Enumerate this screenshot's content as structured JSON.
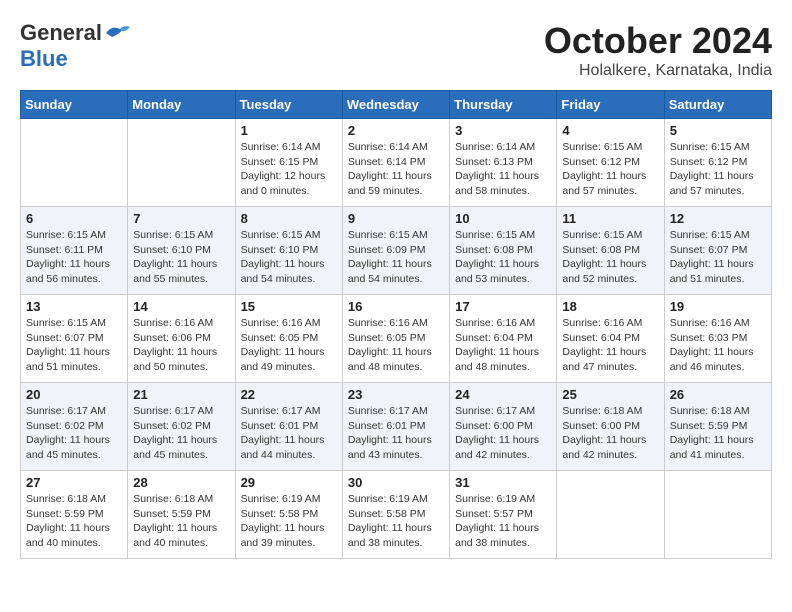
{
  "header": {
    "logo_general": "General",
    "logo_blue": "Blue",
    "month": "October 2024",
    "location": "Holalkere, Karnataka, India"
  },
  "weekdays": [
    "Sunday",
    "Monday",
    "Tuesday",
    "Wednesday",
    "Thursday",
    "Friday",
    "Saturday"
  ],
  "weeks": [
    [
      {
        "day": "",
        "info": ""
      },
      {
        "day": "",
        "info": ""
      },
      {
        "day": "1",
        "info": "Sunrise: 6:14 AM\nSunset: 6:15 PM\nDaylight: 12 hours and 0 minutes."
      },
      {
        "day": "2",
        "info": "Sunrise: 6:14 AM\nSunset: 6:14 PM\nDaylight: 11 hours and 59 minutes."
      },
      {
        "day": "3",
        "info": "Sunrise: 6:14 AM\nSunset: 6:13 PM\nDaylight: 11 hours and 58 minutes."
      },
      {
        "day": "4",
        "info": "Sunrise: 6:15 AM\nSunset: 6:12 PM\nDaylight: 11 hours and 57 minutes."
      },
      {
        "day": "5",
        "info": "Sunrise: 6:15 AM\nSunset: 6:12 PM\nDaylight: 11 hours and 57 minutes."
      }
    ],
    [
      {
        "day": "6",
        "info": "Sunrise: 6:15 AM\nSunset: 6:11 PM\nDaylight: 11 hours and 56 minutes."
      },
      {
        "day": "7",
        "info": "Sunrise: 6:15 AM\nSunset: 6:10 PM\nDaylight: 11 hours and 55 minutes."
      },
      {
        "day": "8",
        "info": "Sunrise: 6:15 AM\nSunset: 6:10 PM\nDaylight: 11 hours and 54 minutes."
      },
      {
        "day": "9",
        "info": "Sunrise: 6:15 AM\nSunset: 6:09 PM\nDaylight: 11 hours and 54 minutes."
      },
      {
        "day": "10",
        "info": "Sunrise: 6:15 AM\nSunset: 6:08 PM\nDaylight: 11 hours and 53 minutes."
      },
      {
        "day": "11",
        "info": "Sunrise: 6:15 AM\nSunset: 6:08 PM\nDaylight: 11 hours and 52 minutes."
      },
      {
        "day": "12",
        "info": "Sunrise: 6:15 AM\nSunset: 6:07 PM\nDaylight: 11 hours and 51 minutes."
      }
    ],
    [
      {
        "day": "13",
        "info": "Sunrise: 6:15 AM\nSunset: 6:07 PM\nDaylight: 11 hours and 51 minutes."
      },
      {
        "day": "14",
        "info": "Sunrise: 6:16 AM\nSunset: 6:06 PM\nDaylight: 11 hours and 50 minutes."
      },
      {
        "day": "15",
        "info": "Sunrise: 6:16 AM\nSunset: 6:05 PM\nDaylight: 11 hours and 49 minutes."
      },
      {
        "day": "16",
        "info": "Sunrise: 6:16 AM\nSunset: 6:05 PM\nDaylight: 11 hours and 48 minutes."
      },
      {
        "day": "17",
        "info": "Sunrise: 6:16 AM\nSunset: 6:04 PM\nDaylight: 11 hours and 48 minutes."
      },
      {
        "day": "18",
        "info": "Sunrise: 6:16 AM\nSunset: 6:04 PM\nDaylight: 11 hours and 47 minutes."
      },
      {
        "day": "19",
        "info": "Sunrise: 6:16 AM\nSunset: 6:03 PM\nDaylight: 11 hours and 46 minutes."
      }
    ],
    [
      {
        "day": "20",
        "info": "Sunrise: 6:17 AM\nSunset: 6:02 PM\nDaylight: 11 hours and 45 minutes."
      },
      {
        "day": "21",
        "info": "Sunrise: 6:17 AM\nSunset: 6:02 PM\nDaylight: 11 hours and 45 minutes."
      },
      {
        "day": "22",
        "info": "Sunrise: 6:17 AM\nSunset: 6:01 PM\nDaylight: 11 hours and 44 minutes."
      },
      {
        "day": "23",
        "info": "Sunrise: 6:17 AM\nSunset: 6:01 PM\nDaylight: 11 hours and 43 minutes."
      },
      {
        "day": "24",
        "info": "Sunrise: 6:17 AM\nSunset: 6:00 PM\nDaylight: 11 hours and 42 minutes."
      },
      {
        "day": "25",
        "info": "Sunrise: 6:18 AM\nSunset: 6:00 PM\nDaylight: 11 hours and 42 minutes."
      },
      {
        "day": "26",
        "info": "Sunrise: 6:18 AM\nSunset: 5:59 PM\nDaylight: 11 hours and 41 minutes."
      }
    ],
    [
      {
        "day": "27",
        "info": "Sunrise: 6:18 AM\nSunset: 5:59 PM\nDaylight: 11 hours and 40 minutes."
      },
      {
        "day": "28",
        "info": "Sunrise: 6:18 AM\nSunset: 5:59 PM\nDaylight: 11 hours and 40 minutes."
      },
      {
        "day": "29",
        "info": "Sunrise: 6:19 AM\nSunset: 5:58 PM\nDaylight: 11 hours and 39 minutes."
      },
      {
        "day": "30",
        "info": "Sunrise: 6:19 AM\nSunset: 5:58 PM\nDaylight: 11 hours and 38 minutes."
      },
      {
        "day": "31",
        "info": "Sunrise: 6:19 AM\nSunset: 5:57 PM\nDaylight: 11 hours and 38 minutes."
      },
      {
        "day": "",
        "info": ""
      },
      {
        "day": "",
        "info": ""
      }
    ]
  ]
}
